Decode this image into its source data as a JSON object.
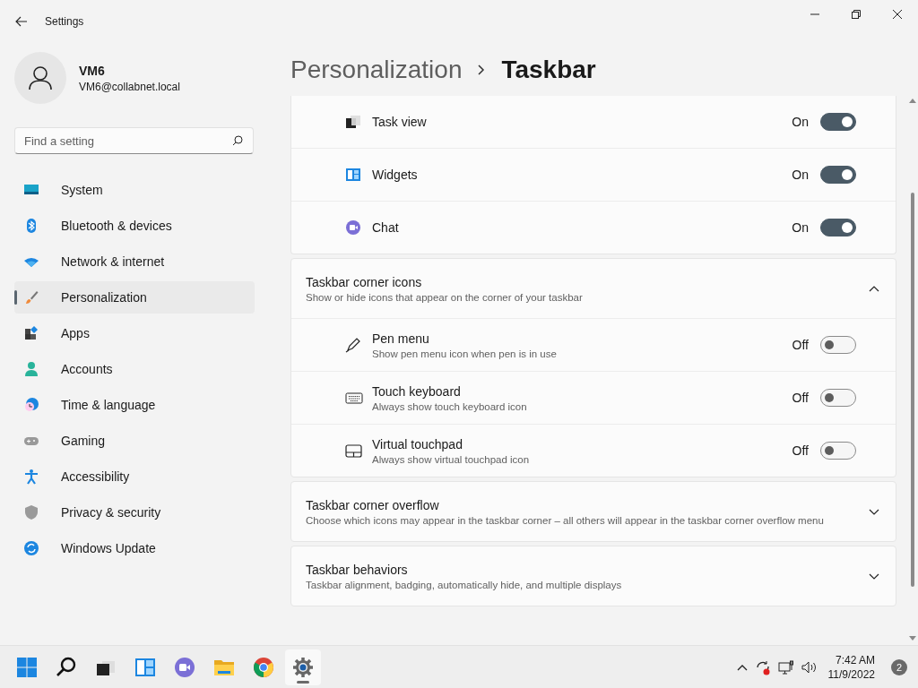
{
  "window": {
    "title": "Settings"
  },
  "user": {
    "name": "VM6",
    "email": "VM6@collabnet.local"
  },
  "search": {
    "placeholder": "Find a setting"
  },
  "sidebar": {
    "items": [
      {
        "kind": "system",
        "label": "System",
        "selected": false
      },
      {
        "kind": "bluetooth",
        "label": "Bluetooth & devices",
        "selected": false
      },
      {
        "kind": "network",
        "label": "Network & internet",
        "selected": false
      },
      {
        "kind": "personalization",
        "label": "Personalization",
        "selected": true
      },
      {
        "kind": "apps",
        "label": "Apps",
        "selected": false
      },
      {
        "kind": "accounts",
        "label": "Accounts",
        "selected": false
      },
      {
        "kind": "time",
        "label": "Time & language",
        "selected": false
      },
      {
        "kind": "gaming",
        "label": "Gaming",
        "selected": false
      },
      {
        "kind": "accessibility",
        "label": "Accessibility",
        "selected": false
      },
      {
        "kind": "privacy",
        "label": "Privacy & security",
        "selected": false
      },
      {
        "kind": "update",
        "label": "Windows Update",
        "selected": false
      }
    ]
  },
  "breadcrumb": {
    "parent": "Personalization",
    "current": "Taskbar"
  },
  "taskbar_items": {
    "rows": [
      {
        "kind": "taskview",
        "label": "Task view",
        "state_text": "On",
        "on": true
      },
      {
        "kind": "widgets",
        "label": "Widgets",
        "state_text": "On",
        "on": true
      },
      {
        "kind": "chat",
        "label": "Chat",
        "state_text": "On",
        "on": true
      }
    ]
  },
  "sections": [
    {
      "title": "Taskbar corner icons",
      "description": "Show or hide icons that appear on the corner of your taskbar",
      "expanded": true,
      "rows": [
        {
          "kind": "pen",
          "label": "Pen menu",
          "description": "Show pen menu icon when pen is in use",
          "state_text": "Off",
          "on": false
        },
        {
          "kind": "keyboard",
          "label": "Touch keyboard",
          "description": "Always show touch keyboard icon",
          "state_text": "Off",
          "on": false
        },
        {
          "kind": "touchpad",
          "label": "Virtual touchpad",
          "description": "Always show virtual touchpad icon",
          "state_text": "Off",
          "on": false
        }
      ]
    },
    {
      "title": "Taskbar corner overflow",
      "description": "Choose which icons may appear in the taskbar corner – all others will appear in the taskbar corner overflow menu",
      "expanded": false
    },
    {
      "title": "Taskbar behaviors",
      "description": "Taskbar alignment, badging, automatically hide, and multiple displays",
      "expanded": false
    }
  ],
  "taskbar": {
    "apps": [
      {
        "kind": "start",
        "selected": false
      },
      {
        "kind": "search",
        "selected": false
      },
      {
        "kind": "taskview",
        "selected": false
      },
      {
        "kind": "widgets",
        "selected": false
      },
      {
        "kind": "chat",
        "selected": false
      },
      {
        "kind": "explorer",
        "selected": false
      },
      {
        "kind": "browser",
        "selected": false
      },
      {
        "kind": "settings",
        "selected": true
      }
    ],
    "time": "7:42 AM",
    "date": "11/9/2022",
    "notification_count": "2"
  }
}
